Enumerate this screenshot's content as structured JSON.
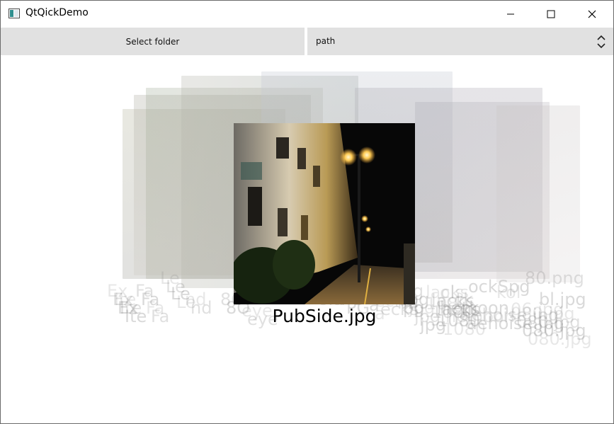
{
  "window": {
    "title": "QtQickDemo"
  },
  "toolbar": {
    "select_folder_label": "Select folder",
    "path_value": "path"
  },
  "icons": {
    "app": "app-window-icon",
    "minimize": "minimize-icon",
    "maximize": "maximize-icon",
    "close": "close-icon",
    "combo": "up-down-chevron-icon"
  },
  "viewer": {
    "current_caption": "PubSide.jpg",
    "background_labels": [
      "Ex",
      "Ex",
      "Ex",
      "Ite",
      "Ite",
      "Ite",
      "Le",
      "Le",
      "Le",
      "Le",
      "Fa",
      "Fa",
      "Fa",
      "Fa",
      "ockSpg",
      "lacks",
      "lacks",
      "lacks",
      "kol",
      "ck",
      "ck",
      "ols",
      "pg",
      "pg",
      "ola",
      "ola",
      "a",
      "a",
      "PG",
      "PG",
      "nd",
      "nd",
      "hemoon",
      "hemoon",
      "jpg",
      "jpg",
      "jpg",
      "jpg",
      "jpg",
      "1080",
      "1080",
      "1080",
      "1080",
      "80.png",
      "bl.jpg",
      "06.jpg",
      "aehoise.jpg",
      "aehoise.jpg",
      "080.jpg",
      "080.jpg",
      "080.jpg",
      "080.jpg",
      "8O",
      "8O",
      "eye",
      "eye",
      "ecks",
      "ecks",
      "ecks"
    ]
  },
  "colors": {
    "button_bg": "#e1e1e1",
    "window_border": "#6b6b6b",
    "caption": "#000000"
  }
}
